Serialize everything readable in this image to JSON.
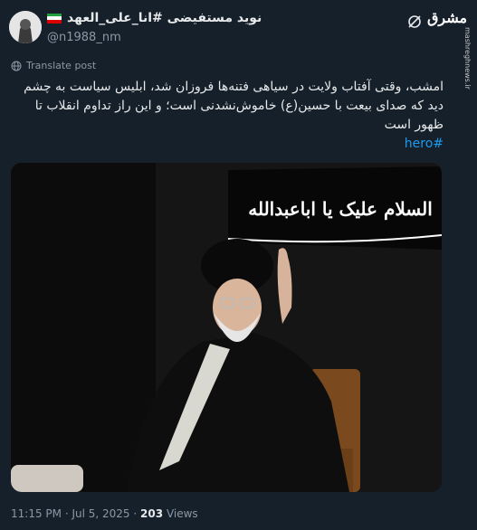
{
  "author": {
    "display_name": "نوید مستفیضی #انا_علی_العهد",
    "handle": "@n1988_nm"
  },
  "brand": {
    "logo_text": "مشرق",
    "watermark": "mashreghnews.ir"
  },
  "translate_label": "Translate post",
  "tweet": {
    "text": "امشب، وقتی آفتاب ولایت در سیاهی فتنه‌ها فروزان شد، ابلیس سیاست به چشم دید که صدای بیعت با حسین(ع) خاموش‌نشدنی است؛ و این راز تداوم انقلاب تا ظهور است",
    "hashtag": "#hero"
  },
  "banner_text": "السلام علیک یا اباعبدالله",
  "meta": {
    "time": "11:15 PM",
    "date": "Jul 5, 2025",
    "views_count": "203",
    "views_label": "Views"
  },
  "colors": {
    "background": "#15202b",
    "link": "#1d9bf0",
    "muted": "#8b98a5"
  }
}
